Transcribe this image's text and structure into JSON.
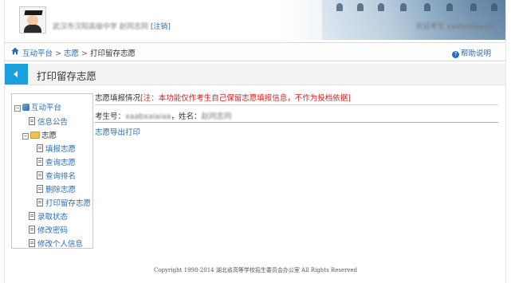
{
  "header": {
    "user_info": "武汉市汉阳高级中学 赵同志同",
    "logout_label": "[注销]",
    "examinee_prefix": "欢迎考生",
    "examinee_id": "xaabcdaiaah"
  },
  "breadcrumb": {
    "items": [
      "互动平台",
      "志愿",
      "打印留存志愿"
    ],
    "separator": ">"
  },
  "help_label": "帮助说明",
  "page_title": "打印留存志愿",
  "tree": {
    "root": "互动平台",
    "items": [
      {
        "label": "信息公告"
      },
      {
        "label": "志愿"
      },
      {
        "label": "填报志愿"
      },
      {
        "label": "查询志愿"
      },
      {
        "label": "查询排名"
      },
      {
        "label": "删除志愿"
      },
      {
        "label": "打印留存志愿"
      },
      {
        "label": "录取状态"
      },
      {
        "label": "修改密码"
      },
      {
        "label": "修改个人信息"
      }
    ],
    "expand_symbol": "−"
  },
  "main": {
    "fill_status_label": "志愿填报情况",
    "fill_status_note": "[注：本功能仅作考生自己保留志愿填报信息，不作为投档依据]",
    "exam_no_label": "考生号：",
    "exam_no_value": "xaabxaiaiaa",
    "name_label": "，姓名：",
    "name_value": "赵同志同",
    "export_link": "志愿导出打印"
  },
  "footer": {
    "copyright": "Copyright 1998-2014 湖北省高等学校招生委员会办公室 All Rights Reserved"
  },
  "colors": {
    "accent": "#1aa1dd",
    "link": "#2b6cb3",
    "warning": "#d41e1e"
  }
}
